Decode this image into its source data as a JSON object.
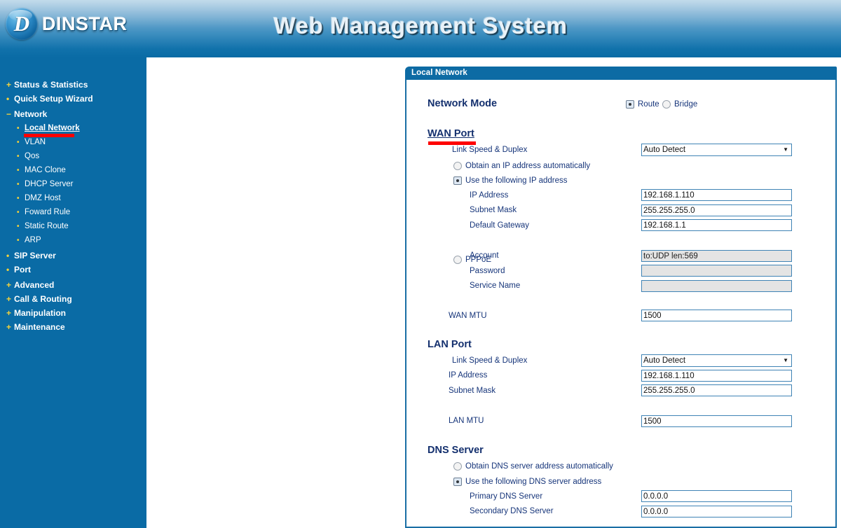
{
  "header": {
    "logo_text": "DINSTAR",
    "logo_letter": "D",
    "title": "Web Management System"
  },
  "sidebar": {
    "items": [
      {
        "label": "Status & Statistics",
        "bullet": "+",
        "level": "top"
      },
      {
        "label": "Quick Setup Wizard",
        "bullet": "•",
        "level": "top"
      },
      {
        "label": "Network",
        "bullet": "−",
        "level": "top"
      },
      {
        "label": "Local Network",
        "bullet": "•",
        "level": "sub",
        "active": true
      },
      {
        "label": "VLAN",
        "bullet": "•",
        "level": "sub"
      },
      {
        "label": "Qos",
        "bullet": "•",
        "level": "sub"
      },
      {
        "label": "MAC Clone",
        "bullet": "•",
        "level": "sub"
      },
      {
        "label": "DHCP Server",
        "bullet": "•",
        "level": "sub"
      },
      {
        "label": "DMZ Host",
        "bullet": "•",
        "level": "sub"
      },
      {
        "label": "Foward Rule",
        "bullet": "•",
        "level": "sub"
      },
      {
        "label": "Static Route",
        "bullet": "•",
        "level": "sub"
      },
      {
        "label": "ARP",
        "bullet": "•",
        "level": "sub"
      },
      {
        "label": "SIP Server",
        "bullet": "•",
        "level": "top"
      },
      {
        "label": "Port",
        "bullet": "•",
        "level": "top"
      },
      {
        "label": "Advanced",
        "bullet": "+",
        "level": "top"
      },
      {
        "label": "Call & Routing",
        "bullet": "+",
        "level": "top"
      },
      {
        "label": "Manipulation",
        "bullet": "+",
        "level": "top"
      },
      {
        "label": "Maintenance",
        "bullet": "+",
        "level": "top"
      }
    ]
  },
  "panel": {
    "title": "Local Network",
    "network_mode": {
      "label": "Network Mode",
      "options": [
        {
          "label": "Route",
          "selected": true
        },
        {
          "label": "Bridge",
          "selected": false
        }
      ]
    },
    "wan": {
      "section": "WAN Port",
      "link_speed_label": "Link Speed & Duplex",
      "link_speed_value": "Auto Detect",
      "obtain_auto_label": "Obtain an IP address automatically",
      "obtain_auto_selected": false,
      "use_static_label": "Use the following IP address",
      "use_static_selected": true,
      "ip_label": "IP Address",
      "ip_value": "192.168.1.110",
      "mask_label": "Subnet Mask",
      "mask_value": "255.255.255.0",
      "gateway_label": "Default Gateway",
      "gateway_value": "192.168.1.1",
      "pppoe_label": "PPPoE",
      "pppoe_selected": false,
      "account_label": "Account",
      "account_value": "to:UDP len:569",
      "password_label": "Password",
      "password_value": "",
      "service_name_label": "Service Name",
      "service_name_value": "",
      "mtu_label": "WAN MTU",
      "mtu_value": "1500"
    },
    "lan": {
      "section": "LAN Port",
      "link_speed_label": "Link Speed & Duplex",
      "link_speed_value": "Auto Detect",
      "ip_label": "IP Address",
      "ip_value": "192.168.1.110",
      "mask_label": "Subnet Mask",
      "mask_value": "255.255.255.0",
      "mtu_label": "LAN MTU",
      "mtu_value": "1500"
    },
    "dns": {
      "section": "DNS Server",
      "auto_label": "Obtain DNS server address automatically",
      "auto_selected": false,
      "manual_label": "Use the following DNS server address",
      "manual_selected": true,
      "primary_label": "Primary DNS Server",
      "primary_value": "0.0.0.0",
      "secondary_label": "Secondary DNS Server",
      "secondary_value": "0.0.0.0"
    }
  },
  "colors": {
    "brand_blue": "#0a6ba5",
    "accent_red": "#fe0000",
    "label_blue": "#16357a",
    "bullet_gold": "#f3d23c"
  }
}
